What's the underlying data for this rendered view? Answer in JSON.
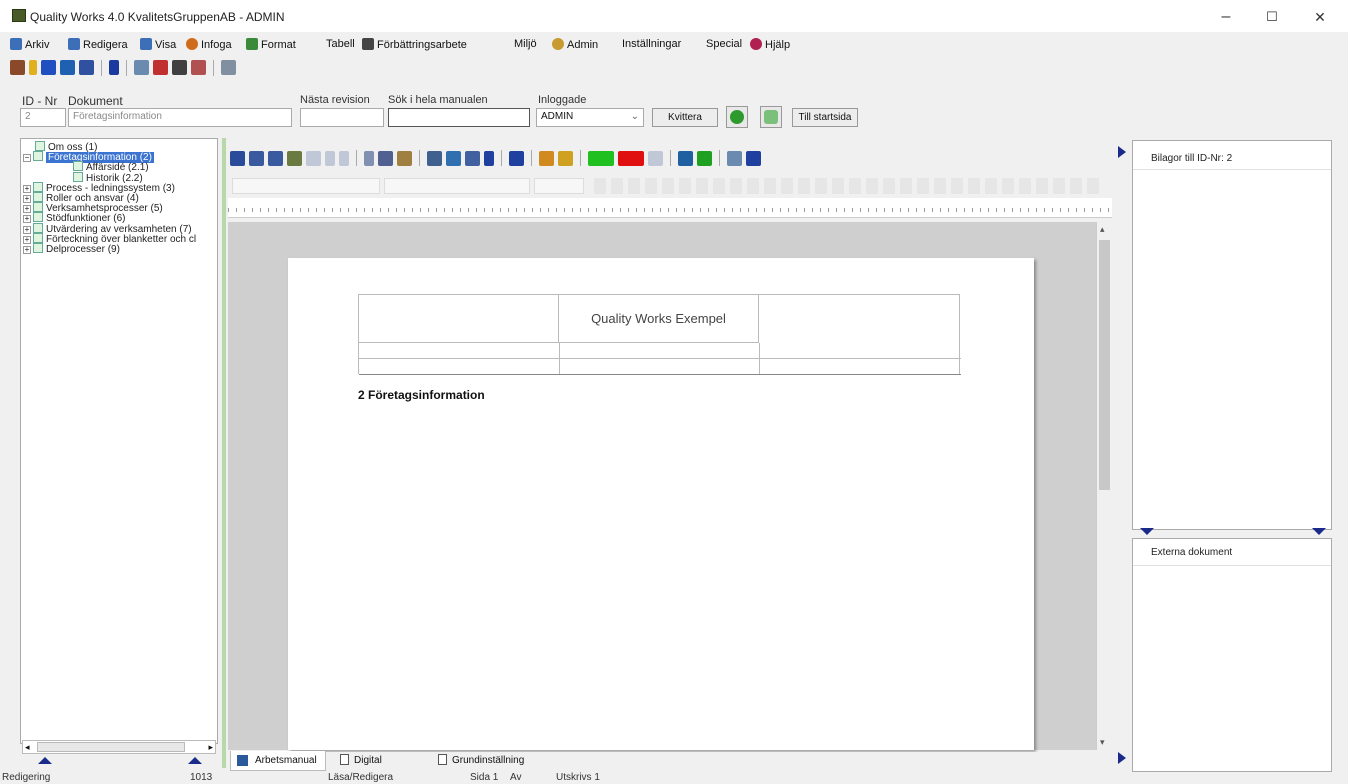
{
  "window": {
    "title": "Quality Works 4.0 KvalitetsGruppenAB - ADMIN",
    "minimize": "–",
    "maximize": "☐",
    "close": "✕"
  },
  "menu": [
    {
      "label": "Arkiv",
      "color": "#3c6fb8"
    },
    {
      "label": "Redigera",
      "color": "#3c6fb8"
    },
    {
      "label": "Visa",
      "color": "#3c6fb8"
    },
    {
      "label": "Infoga",
      "color": "#d06a1c"
    },
    {
      "label": "Format",
      "color": "#3a8a3a"
    },
    {
      "label": "Tabell",
      "color": ""
    },
    {
      "label": "Förbättringsarbete",
      "color": "#444"
    },
    {
      "label": "Miljö",
      "color": ""
    },
    {
      "label": "Admin",
      "color": "#c89a30"
    },
    {
      "label": "Inställningar",
      "color": ""
    },
    {
      "label": "Special",
      "color": ""
    },
    {
      "label": "Hjälp",
      "color": "#b02050"
    }
  ],
  "toolbar_icons": [
    "user-icon",
    "pin-icon",
    "blue-square-icon",
    "book-icon",
    "grid-icon",
    "blue-book-icon",
    "print-icon",
    "pdf-icon",
    "people-icon",
    "export-icon",
    "settings-icon"
  ],
  "fields": {
    "id_label": "ID - Nr",
    "id_value": "2",
    "dokument_label": "Dokument",
    "dokument_value": "Företagsinformation",
    "nasta_label": "Nästa revision",
    "sok_label": "Sök i hela manualen",
    "inloggade_label": "Inloggade",
    "inloggade_value": "ADMIN",
    "kvittera": "Kvittera",
    "tillstatsida": "Till startsida"
  },
  "tree": {
    "items": [
      {
        "label": "Om oss (1)",
        "level": 0,
        "expander": "",
        "selected": false
      },
      {
        "label": "Företagsinformation (2)",
        "level": 0,
        "expander": "−",
        "selected": true
      },
      {
        "label": "Affärsidé (2.1)",
        "level": 1,
        "expander": "",
        "selected": false
      },
      {
        "label": "Historik (2.2)",
        "level": 1,
        "expander": "",
        "selected": false
      },
      {
        "label": "Process - ledningssystem (3)",
        "level": 0,
        "expander": "+",
        "selected": false
      },
      {
        "label": "Roller och ansvar (4)",
        "level": 0,
        "expander": "+",
        "selected": false
      },
      {
        "label": "Verksamhetsprocesser (5)",
        "level": 0,
        "expander": "+",
        "selected": false
      },
      {
        "label": "Stödfunktioner (6)",
        "level": 0,
        "expander": "+",
        "selected": false
      },
      {
        "label": "Utvärdering av verksamheten (7)",
        "level": 0,
        "expander": "+",
        "selected": false
      },
      {
        "label": "Förteckning över blanketter och cl",
        "level": 0,
        "expander": "+",
        "selected": false
      },
      {
        "label": "Delprocesser (9)",
        "level": 0,
        "expander": "+",
        "selected": false
      }
    ]
  },
  "document": {
    "header_title": "Quality Works Exempel",
    "heading": "2 Företagsinformation"
  },
  "tabs": [
    {
      "label": "Arbetsmanual"
    },
    {
      "label": "Digital"
    },
    {
      "label": "Grundinställning"
    }
  ],
  "right_panel": {
    "bilagor": "Bilagor till ID-Nr: 2",
    "externa": "Externa dokument"
  },
  "status": {
    "mode": "Redigering",
    "number": "1013",
    "edit_state": "Läsa/Redigera",
    "page": "Sida 1",
    "av": "Av",
    "utskrift": "Utskrivs 1"
  }
}
